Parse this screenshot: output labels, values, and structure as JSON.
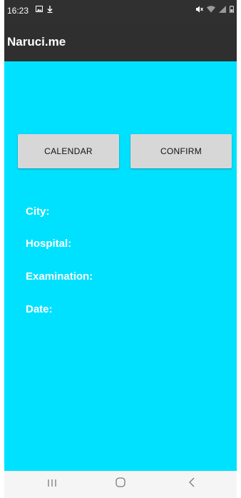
{
  "status_bar": {
    "time": "16:23",
    "left_icons": [
      "image-icon",
      "download-icon"
    ],
    "right_icons": [
      "mute-icon",
      "wifi-icon",
      "signal-icon",
      "battery-icon"
    ]
  },
  "app_bar": {
    "title": "Naruci.me"
  },
  "buttons": {
    "calendar": "CALENDAR",
    "confirm": "CONFIRM"
  },
  "fields": [
    {
      "label": "City:",
      "value": ""
    },
    {
      "label": "Hospital:",
      "value": ""
    },
    {
      "label": "Examination:",
      "value": ""
    },
    {
      "label": "Date:",
      "value": ""
    }
  ],
  "nav_bar": {
    "recent_icon": "recent-apps-icon",
    "home_icon": "home-icon",
    "back_icon": "back-icon"
  },
  "colors": {
    "status_bar": "#303030",
    "app_bar": "#2f2f2f",
    "content_background": "#00e1ff",
    "button": "#d7d7d7",
    "label_text": "#ffffff",
    "nav_bar": "#f5f5f5"
  }
}
